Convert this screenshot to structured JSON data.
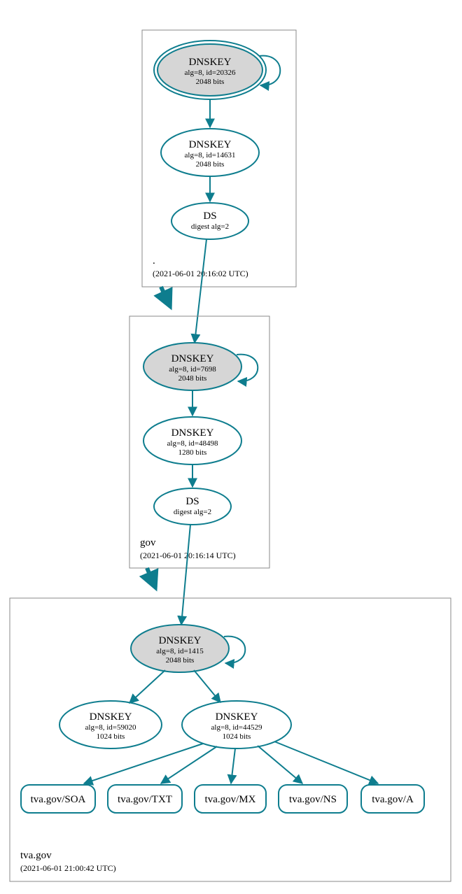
{
  "colors": {
    "edge": "#0e7d8e",
    "ksk_fill": "#d6d6d6",
    "box_stroke": "#888888"
  },
  "zones": [
    {
      "name": ".",
      "timestamp": "(2021-06-01 20:16:02 UTC)",
      "nodes": [
        {
          "id": "root-ksk",
          "type": "DNSKEY",
          "line2": "alg=8, id=20326",
          "line3": "2048 bits",
          "ksk": true,
          "trust_anchor": true
        },
        {
          "id": "root-zsk",
          "type": "DNSKEY",
          "line2": "alg=8, id=14631",
          "line3": "2048 bits",
          "ksk": false
        },
        {
          "id": "root-ds",
          "type": "DS",
          "line2": "digest alg=2",
          "line3": ""
        }
      ]
    },
    {
      "name": "gov",
      "timestamp": "(2021-06-01 20:16:14 UTC)",
      "nodes": [
        {
          "id": "gov-ksk",
          "type": "DNSKEY",
          "line2": "alg=8, id=7698",
          "line3": "2048 bits",
          "ksk": true
        },
        {
          "id": "gov-zsk",
          "type": "DNSKEY",
          "line2": "alg=8, id=48498",
          "line3": "1280 bits",
          "ksk": false
        },
        {
          "id": "gov-ds",
          "type": "DS",
          "line2": "digest alg=2",
          "line3": ""
        }
      ]
    },
    {
      "name": "tva.gov",
      "timestamp": "(2021-06-01 21:00:42 UTC)",
      "nodes": [
        {
          "id": "tva-ksk",
          "type": "DNSKEY",
          "line2": "alg=8, id=1415",
          "line3": "2048 bits",
          "ksk": true
        },
        {
          "id": "tva-zsk1",
          "type": "DNSKEY",
          "line2": "alg=8, id=59020",
          "line3": "1024 bits",
          "ksk": false
        },
        {
          "id": "tva-zsk2",
          "type": "DNSKEY",
          "line2": "alg=8, id=44529",
          "line3": "1024 bits",
          "ksk": false
        }
      ],
      "records": [
        {
          "id": "rec-soa",
          "label": "tva.gov/SOA"
        },
        {
          "id": "rec-txt",
          "label": "tva.gov/TXT"
        },
        {
          "id": "rec-mx",
          "label": "tva.gov/MX"
        },
        {
          "id": "rec-ns",
          "label": "tva.gov/NS"
        },
        {
          "id": "rec-a",
          "label": "tva.gov/A"
        }
      ]
    }
  ]
}
